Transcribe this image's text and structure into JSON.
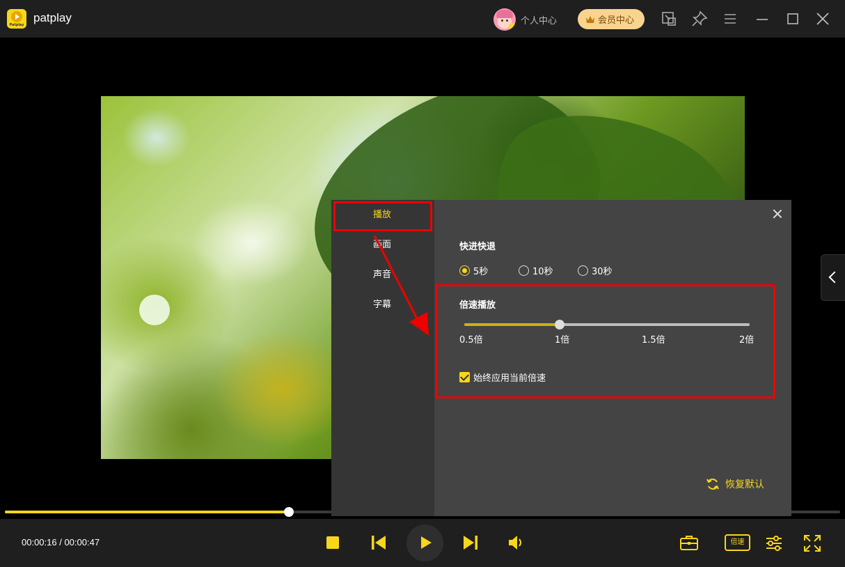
{
  "app": {
    "name": "patplay",
    "logo_text": "Patplay"
  },
  "titlebar": {
    "user_center_label": "个人中心",
    "vip_label": "会员中心",
    "icons": [
      "screen-cast-icon",
      "pin-icon",
      "menu-icon",
      "minimize-icon",
      "maximize-icon",
      "close-icon"
    ]
  },
  "colors": {
    "accent": "#f8d61c",
    "panel_bg": "#444444",
    "nav_bg": "#353535",
    "highlight": "#ee0000"
  },
  "player": {
    "current_time": "00:00:16",
    "total_time": "00:00:47",
    "time_display": "00:00:16 / 00:00:47",
    "progress": 0.34,
    "speed_button_label": "倍速"
  },
  "settings_panel": {
    "nav": [
      {
        "label": "播放",
        "active": true
      },
      {
        "label": "画面",
        "active": false
      },
      {
        "label": "声音",
        "active": false
      },
      {
        "label": "字幕",
        "active": false
      }
    ],
    "seek": {
      "title": "快进快退",
      "options": [
        {
          "label": "5秒",
          "selected": true
        },
        {
          "label": "10秒",
          "selected": false
        },
        {
          "label": "30秒",
          "selected": false
        }
      ]
    },
    "speed": {
      "title": "倍速播放",
      "ticks": [
        "0.5倍",
        "1倍",
        "1.5倍",
        "2倍"
      ],
      "value": 1,
      "min": 0.5,
      "max": 2,
      "always_apply_label": "始终应用当前倍速",
      "always_apply_checked": true
    },
    "reset_label": "恢复默认"
  }
}
